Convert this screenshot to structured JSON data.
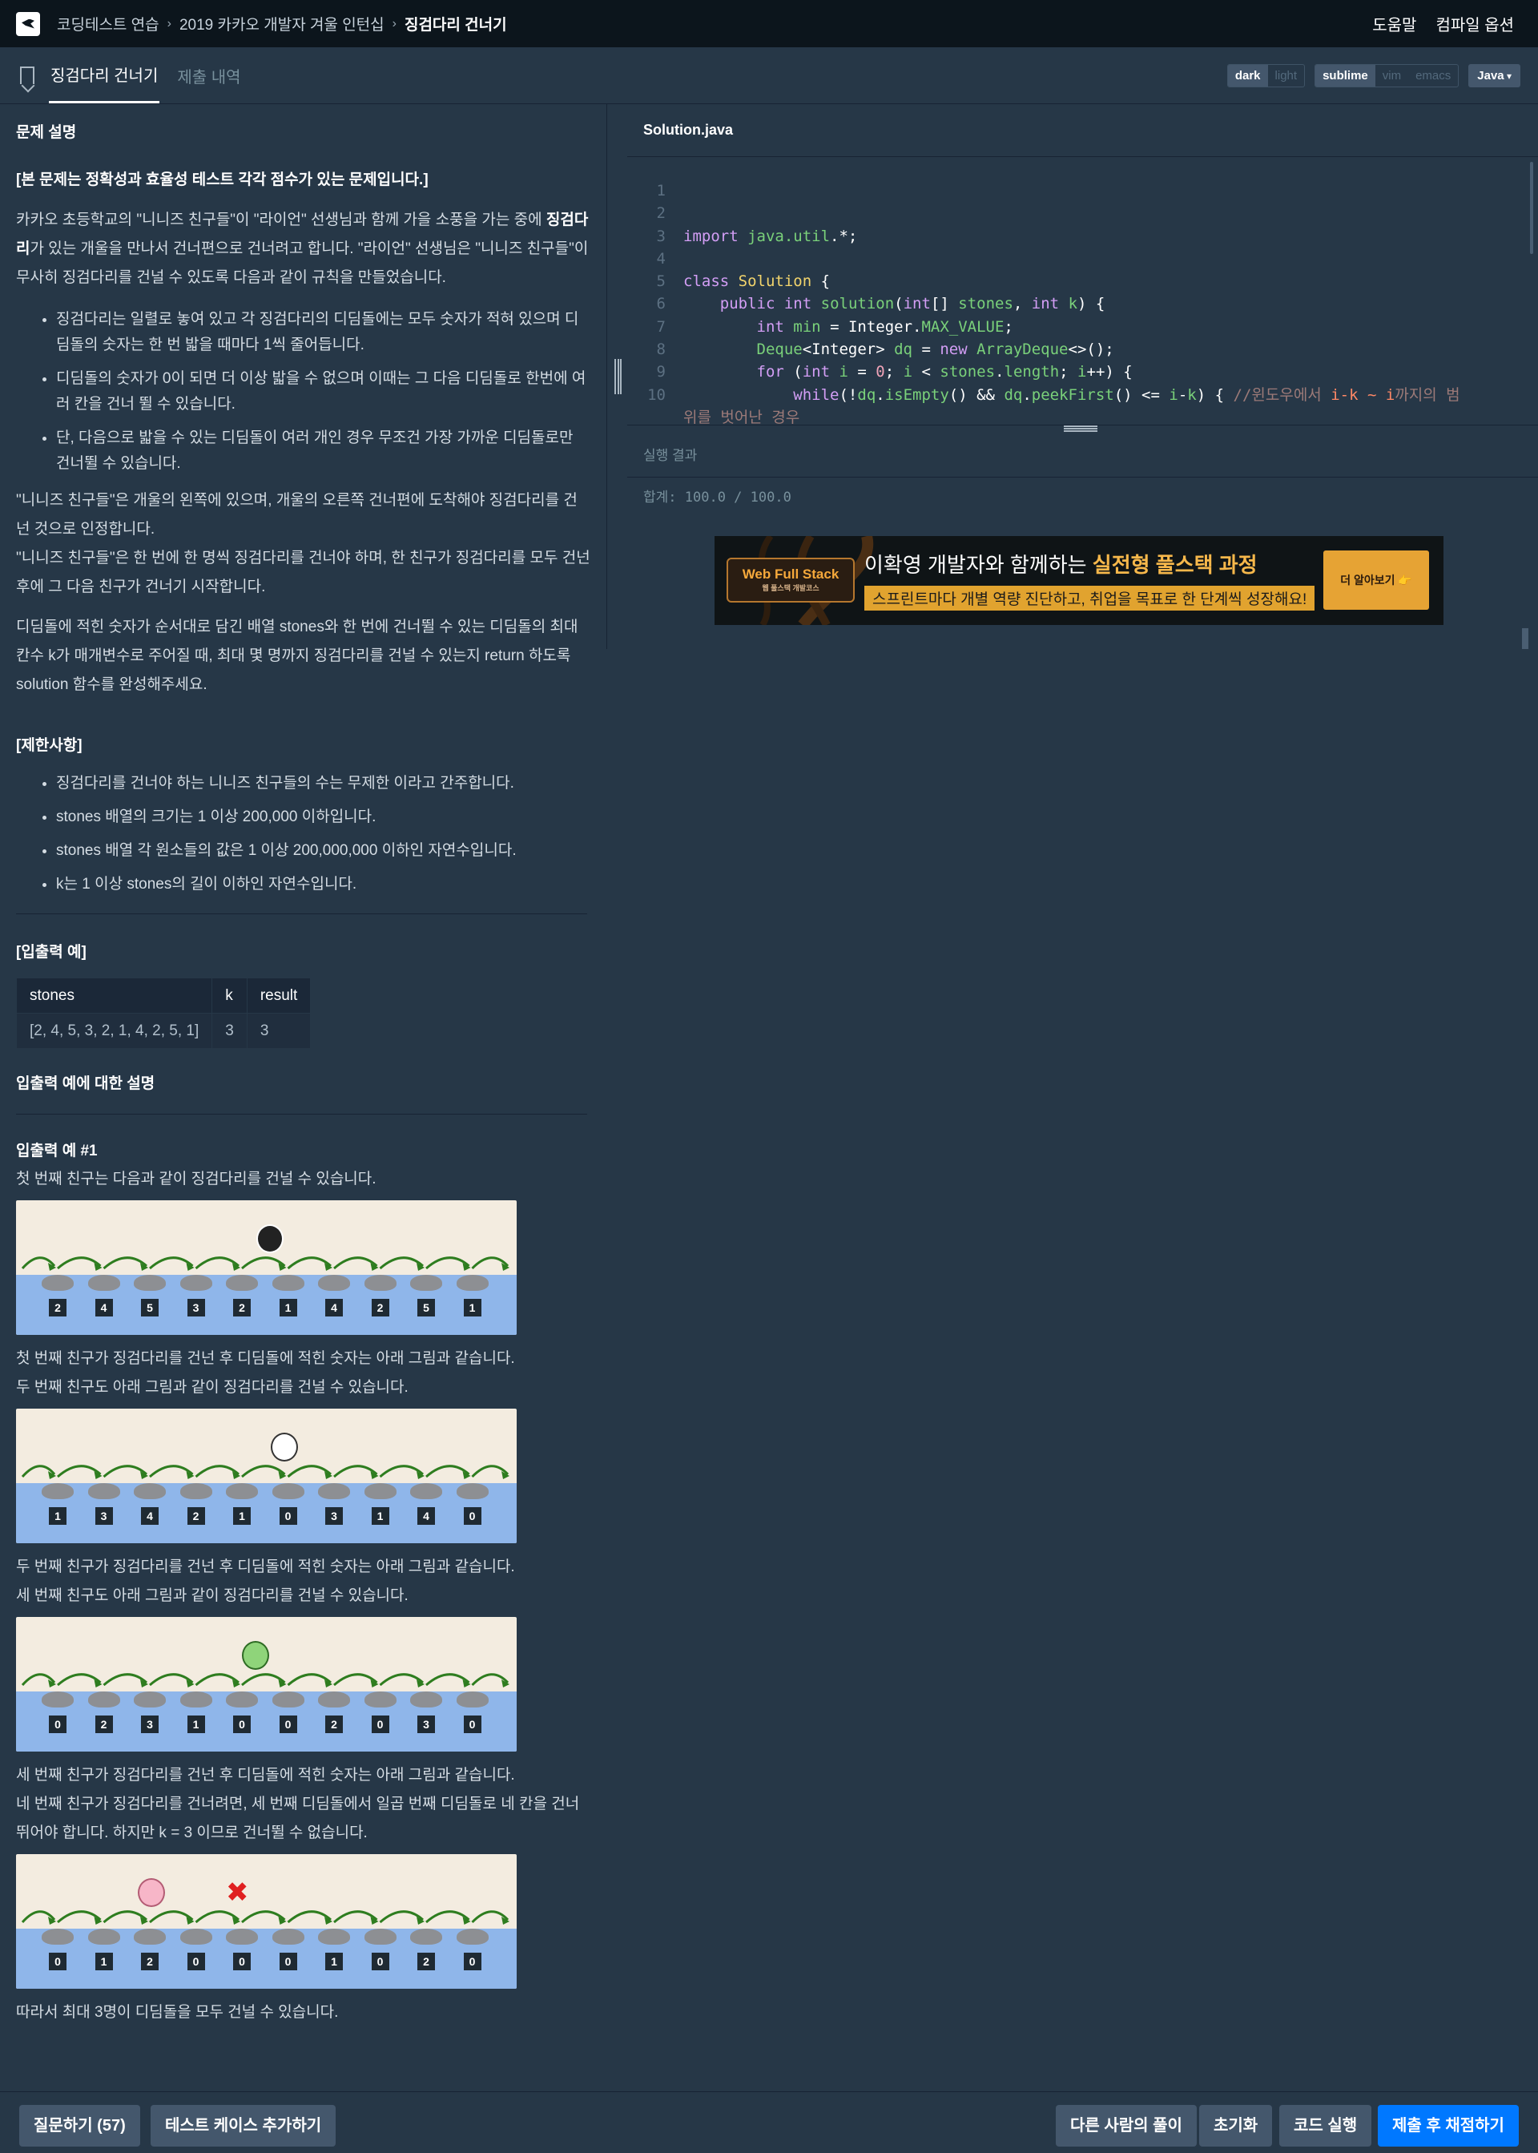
{
  "nav": {
    "crumbs": [
      "코딩테스트 연습",
      "2019 카카오 개발자 겨울 인턴십",
      "징검다리 건너기"
    ],
    "help": "도움말",
    "compile_options": "컴파일 옵션"
  },
  "tabs": {
    "problem": "징검다리 건너기",
    "history": "제출 내역"
  },
  "editor_options": {
    "themes": [
      "dark",
      "light"
    ],
    "active_theme": "dark",
    "keymaps": [
      "sublime",
      "vim",
      "emacs"
    ],
    "active_keymap": "sublime",
    "language": "Java"
  },
  "problem": {
    "section_title": "문제 설명",
    "notice": "[본 문제는 정확성과 효율성 테스트 각각 점수가 있는 문제입니다.]",
    "intro_1": "카카오 초등학교의 \"니니즈 친구들\"이 \"라이언\" 선생님과 함께 가을 소풍을 가는 중에 ",
    "intro_bold": "징검다리",
    "intro_2": "가 있는 개울을 만나서 건너편으로 건너려고 합니다. \"라이언\" 선생님은 \"니니즈 친구들\"이 무사히 징검다리를 건널 수 있도록 다음과 같이 규칙을 만들었습니다.",
    "rules": [
      "징검다리는 일렬로 놓여 있고 각 징검다리의 디딤돌에는 모두 숫자가 적혀 있으며 디딤돌의 숫자는 한 번 밟을 때마다 1씩 줄어듭니다.",
      "디딤돌의 숫자가 0이 되면 더 이상 밟을 수 없으며 이때는 그 다음 디딤돌로 한번에 여러 칸을 건너 뛸 수 있습니다.",
      "단, 다음으로 밟을 수 있는 디딤돌이 여러 개인 경우 무조건 가장 가까운 디딤돌로만 건너뛸 수 있습니다."
    ],
    "para_2a": "\"니니즈 친구들\"은 개울의 왼쪽에 있으며, 개울의 오른쪽 건너편에 도착해야 징검다리를 건넌 것으로 인정합니다.",
    "para_2b": "\"니니즈 친구들\"은 한 번에 한 명씩 징검다리를 건너야 하며, 한 친구가 징검다리를 모두 건넌 후에 그 다음 친구가 건너기 시작합니다.",
    "para_3": "디딤돌에 적힌 숫자가 순서대로 담긴 배열 stones와 한 번에 건너뛸 수 있는 디딤돌의 최대 칸수 k가 매개변수로 주어질 때, 최대 몇 명까지 징검다리를 건널 수 있는지 return 하도록 solution 함수를 완성해주세요.",
    "constraints_title": "[제한사항]",
    "constraints": [
      "징검다리를 건너야 하는 니니즈 친구들의 수는 무제한 이라고 간주합니다.",
      "stones 배열의 크기는 1 이상 200,000 이하입니다.",
      "stones 배열 각 원소들의 값은 1 이상 200,000,000 이하인 자연수입니다.",
      "k는 1 이상 stones의 길이 이하인 자연수입니다."
    ],
    "io_title": "[입출력 예]",
    "io_headers": [
      "stones",
      "k",
      "result"
    ],
    "io_rows": [
      [
        "[2, 4, 5, 3, 2, 1, 4, 2, 5, 1]",
        "3",
        "3"
      ]
    ],
    "io_explain_title": "입출력 예에 대한 설명",
    "example_title": "입출력 예 #1",
    "ex_line_1": "첫 번째 친구는 다음과 같이 징검다리를 건널 수 있습니다.",
    "ex_line_2a": "첫 번째 친구가 징검다리를 건넌 후 디딤돌에 적힌 숫자는 아래 그림과 같습니다.",
    "ex_line_2b": "두 번째 친구도 아래 그림과 같이 징검다리를 건널 수 있습니다.",
    "ex_line_3a": "두 번째 친구가 징검다리를 건넌 후 디딤돌에 적힌 숫자는 아래 그림과 같습니다.",
    "ex_line_3b": "세 번째 친구도 아래 그림과 같이 징검다리를 건널 수 있습니다.",
    "ex_line_4a": "세 번째 친구가 징검다리를 건넌 후 디딤돌에 적힌 숫자는 아래 그림과 같습니다.",
    "ex_line_4b": "네 번째 친구가 징검다리를 건너려면, 세 번째 디딤돌에서 일곱 번째 디딤돌로 네 칸을 건너뛰어야 합니다. 하지만 k = 3 이므로 건너뛸 수 없습니다.",
    "ex_line_5": "따라서 최대 3명이 디딤돌을 모두 건널 수 있습니다.",
    "figures": [
      {
        "stones": [
          "2",
          "4",
          "5",
          "3",
          "2",
          "1",
          "4",
          "2",
          "5",
          "1"
        ],
        "character": "penguin"
      },
      {
        "stones": [
          "1",
          "3",
          "4",
          "2",
          "1",
          "0",
          "3",
          "1",
          "4",
          "0"
        ],
        "character": "white-blob"
      },
      {
        "stones": [
          "0",
          "2",
          "3",
          "1",
          "0",
          "0",
          "2",
          "0",
          "3",
          "0"
        ],
        "character": "green-leaf"
      },
      {
        "stones": [
          "0",
          "1",
          "2",
          "0",
          "0",
          "0",
          "1",
          "0",
          "2",
          "0"
        ],
        "character": "pink-bunny"
      }
    ]
  },
  "code": {
    "filename": "Solution.java",
    "line_numbers": [
      "1",
      "2",
      "3",
      "4",
      "5",
      "6",
      "7",
      "8",
      "9",
      "10"
    ]
  },
  "result": {
    "title": "실행 결과",
    "total": "합계: 100.0 / 100.0"
  },
  "ad": {
    "logo_main": "Web Full Stack",
    "logo_sub": "웹 풀스택 개발코스",
    "headline_plain": "이확영 개발자와 함께하는 ",
    "headline_bold": "실전형 풀스택 과정",
    "subline": "스프린트마다 개별 역량 진단하고, 취업을 목표로 한 단계씩 성장해요!",
    "cta": "더 알아보기 👉"
  },
  "footer": {
    "ask": "질문하기 (57)",
    "add_testcase": "테스트 케이스 추가하기",
    "others": "다른 사람의 풀이",
    "reset": "초기화",
    "run": "코드 실행",
    "submit": "제출 후 채점하기"
  },
  "colors": {
    "nav_bg": "#0c151c",
    "panel_bg": "#263747",
    "primary": "#0078ff",
    "secondary_btn": "#44576c"
  }
}
